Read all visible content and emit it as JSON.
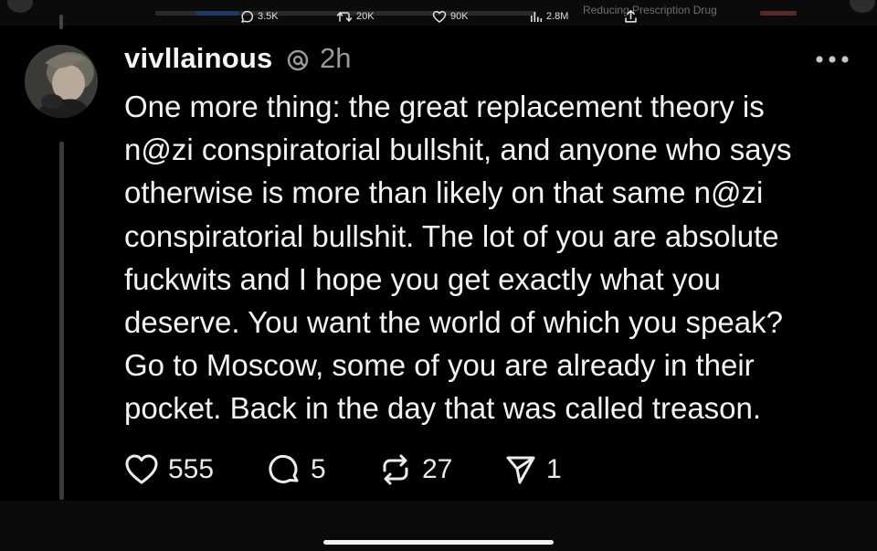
{
  "header_strip": {
    "partial_text": "Reducing Prescription Drug"
  },
  "post": {
    "username": "vivllainous",
    "timestamp": "2h",
    "text_lines": [
      "One more thing: the great replacement theory is",
      "n@zi conspiratorial bullshit, and anyone who says",
      "otherwise is more than likely on that same n@zi",
      "conspiratorial bullshit. The lot of you are absolute",
      "fuckwits and I hope you get exactly what you",
      "deserve. You want the world of which you speak?",
      "Go to Moscow, some of you are already in their",
      "pocket. Back in the day that was called treason."
    ],
    "actions": {
      "likes": "555",
      "replies": "5",
      "reposts": "27",
      "shares": "1"
    }
  },
  "bottom_stats": {
    "replies": "3.5K",
    "reposts": "20K",
    "likes": "90K",
    "views": "2.8M"
  },
  "icons": {
    "verified": "threads-badge-icon",
    "more": "more-horizontal-icon",
    "like": "heart-icon",
    "reply": "speech-bubble-icon",
    "repost": "repost-arrows-icon",
    "share": "send-icon",
    "views": "bar-chart-icon",
    "upload": "upload-icon"
  }
}
